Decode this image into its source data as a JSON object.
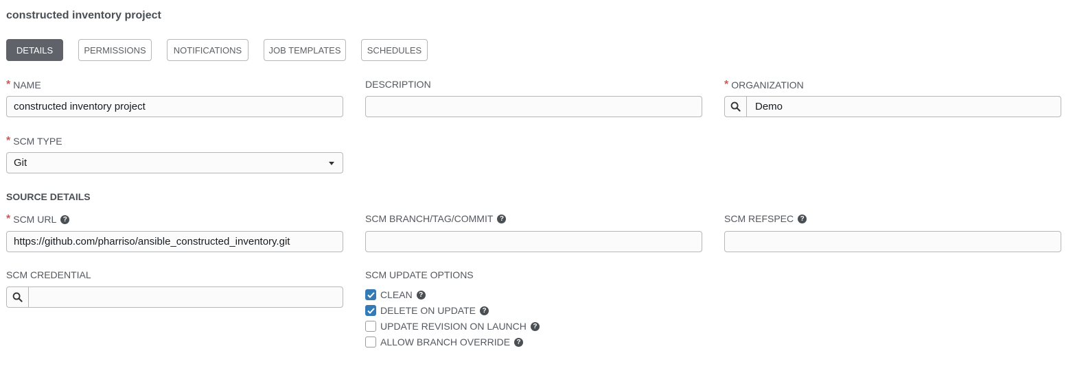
{
  "title": "constructed inventory project",
  "tabs": [
    {
      "label": "DETAILS"
    },
    {
      "label": "PERMISSIONS"
    },
    {
      "label": "NOTIFICATIONS"
    },
    {
      "label": "JOB TEMPLATES"
    },
    {
      "label": "SCHEDULES"
    }
  ],
  "form": {
    "name": {
      "label": "NAME",
      "value": "constructed inventory project"
    },
    "description": {
      "label": "DESCRIPTION",
      "value": ""
    },
    "organization": {
      "label": "ORGANIZATION",
      "value": "Demo"
    },
    "scm_type": {
      "label": "SCM TYPE",
      "value": "Git"
    },
    "source_details_heading": "SOURCE DETAILS",
    "scm_url": {
      "label": "SCM URL",
      "value": "https://github.com/pharriso/ansible_constructed_inventory.git"
    },
    "scm_branch": {
      "label": "SCM BRANCH/TAG/COMMIT",
      "value": ""
    },
    "scm_refspec": {
      "label": "SCM REFSPEC",
      "value": ""
    },
    "scm_credential": {
      "label": "SCM CREDENTIAL",
      "value": ""
    },
    "scm_update_options": {
      "label": "SCM UPDATE OPTIONS",
      "options": [
        {
          "label": "CLEAN",
          "checked": true
        },
        {
          "label": "DELETE ON UPDATE",
          "checked": true
        },
        {
          "label": "UPDATE REVISION ON LAUNCH",
          "checked": false
        },
        {
          "label": "ALLOW BRANCH OVERRIDE",
          "checked": false
        }
      ]
    }
  },
  "icons": {
    "help": "question-circle-icon",
    "search": "search-icon",
    "check": "checkmark-icon"
  },
  "colors": {
    "active_tab": "#5f6369",
    "required": "#d9534f",
    "checkbox_checked": "#337ab7"
  }
}
